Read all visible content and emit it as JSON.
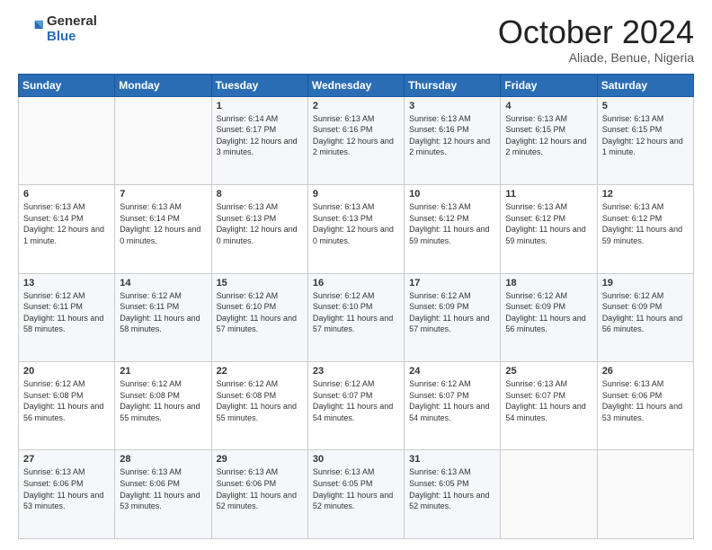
{
  "logo": {
    "general": "General",
    "blue": "Blue"
  },
  "header": {
    "month": "October 2024",
    "location": "Aliade, Benue, Nigeria"
  },
  "days_of_week": [
    "Sunday",
    "Monday",
    "Tuesday",
    "Wednesday",
    "Thursday",
    "Friday",
    "Saturday"
  ],
  "weeks": [
    [
      {
        "day": "",
        "content": ""
      },
      {
        "day": "",
        "content": ""
      },
      {
        "day": "1",
        "content": "Sunrise: 6:14 AM\nSunset: 6:17 PM\nDaylight: 12 hours and 3 minutes."
      },
      {
        "day": "2",
        "content": "Sunrise: 6:13 AM\nSunset: 6:16 PM\nDaylight: 12 hours and 2 minutes."
      },
      {
        "day": "3",
        "content": "Sunrise: 6:13 AM\nSunset: 6:16 PM\nDaylight: 12 hours and 2 minutes."
      },
      {
        "day": "4",
        "content": "Sunrise: 6:13 AM\nSunset: 6:15 PM\nDaylight: 12 hours and 2 minutes."
      },
      {
        "day": "5",
        "content": "Sunrise: 6:13 AM\nSunset: 6:15 PM\nDaylight: 12 hours and 1 minute."
      }
    ],
    [
      {
        "day": "6",
        "content": "Sunrise: 6:13 AM\nSunset: 6:14 PM\nDaylight: 12 hours and 1 minute."
      },
      {
        "day": "7",
        "content": "Sunrise: 6:13 AM\nSunset: 6:14 PM\nDaylight: 12 hours and 0 minutes."
      },
      {
        "day": "8",
        "content": "Sunrise: 6:13 AM\nSunset: 6:13 PM\nDaylight: 12 hours and 0 minutes."
      },
      {
        "day": "9",
        "content": "Sunrise: 6:13 AM\nSunset: 6:13 PM\nDaylight: 12 hours and 0 minutes."
      },
      {
        "day": "10",
        "content": "Sunrise: 6:13 AM\nSunset: 6:12 PM\nDaylight: 11 hours and 59 minutes."
      },
      {
        "day": "11",
        "content": "Sunrise: 6:13 AM\nSunset: 6:12 PM\nDaylight: 11 hours and 59 minutes."
      },
      {
        "day": "12",
        "content": "Sunrise: 6:13 AM\nSunset: 6:12 PM\nDaylight: 11 hours and 59 minutes."
      }
    ],
    [
      {
        "day": "13",
        "content": "Sunrise: 6:12 AM\nSunset: 6:11 PM\nDaylight: 11 hours and 58 minutes."
      },
      {
        "day": "14",
        "content": "Sunrise: 6:12 AM\nSunset: 6:11 PM\nDaylight: 11 hours and 58 minutes."
      },
      {
        "day": "15",
        "content": "Sunrise: 6:12 AM\nSunset: 6:10 PM\nDaylight: 11 hours and 57 minutes."
      },
      {
        "day": "16",
        "content": "Sunrise: 6:12 AM\nSunset: 6:10 PM\nDaylight: 11 hours and 57 minutes."
      },
      {
        "day": "17",
        "content": "Sunrise: 6:12 AM\nSunset: 6:09 PM\nDaylight: 11 hours and 57 minutes."
      },
      {
        "day": "18",
        "content": "Sunrise: 6:12 AM\nSunset: 6:09 PM\nDaylight: 11 hours and 56 minutes."
      },
      {
        "day": "19",
        "content": "Sunrise: 6:12 AM\nSunset: 6:09 PM\nDaylight: 11 hours and 56 minutes."
      }
    ],
    [
      {
        "day": "20",
        "content": "Sunrise: 6:12 AM\nSunset: 6:08 PM\nDaylight: 11 hours and 56 minutes."
      },
      {
        "day": "21",
        "content": "Sunrise: 6:12 AM\nSunset: 6:08 PM\nDaylight: 11 hours and 55 minutes."
      },
      {
        "day": "22",
        "content": "Sunrise: 6:12 AM\nSunset: 6:08 PM\nDaylight: 11 hours and 55 minutes."
      },
      {
        "day": "23",
        "content": "Sunrise: 6:12 AM\nSunset: 6:07 PM\nDaylight: 11 hours and 54 minutes."
      },
      {
        "day": "24",
        "content": "Sunrise: 6:12 AM\nSunset: 6:07 PM\nDaylight: 11 hours and 54 minutes."
      },
      {
        "day": "25",
        "content": "Sunrise: 6:13 AM\nSunset: 6:07 PM\nDaylight: 11 hours and 54 minutes."
      },
      {
        "day": "26",
        "content": "Sunrise: 6:13 AM\nSunset: 6:06 PM\nDaylight: 11 hours and 53 minutes."
      }
    ],
    [
      {
        "day": "27",
        "content": "Sunrise: 6:13 AM\nSunset: 6:06 PM\nDaylight: 11 hours and 53 minutes."
      },
      {
        "day": "28",
        "content": "Sunrise: 6:13 AM\nSunset: 6:06 PM\nDaylight: 11 hours and 53 minutes."
      },
      {
        "day": "29",
        "content": "Sunrise: 6:13 AM\nSunset: 6:06 PM\nDaylight: 11 hours and 52 minutes."
      },
      {
        "day": "30",
        "content": "Sunrise: 6:13 AM\nSunset: 6:05 PM\nDaylight: 11 hours and 52 minutes."
      },
      {
        "day": "31",
        "content": "Sunrise: 6:13 AM\nSunset: 6:05 PM\nDaylight: 11 hours and 52 minutes."
      },
      {
        "day": "",
        "content": ""
      },
      {
        "day": "",
        "content": ""
      }
    ]
  ]
}
